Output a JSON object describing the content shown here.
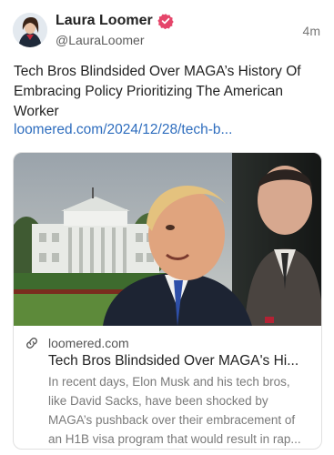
{
  "post": {
    "author": {
      "name": "Laura Loomer",
      "handle": "@LauraLoomer",
      "verified_icon": "verified-badge-icon",
      "verified_color": "#e5456a"
    },
    "time": "4m",
    "text": "Tech Bros Blindsided Over MAGA’s History Of Embracing Policy Prioritizing The American Worker",
    "link": "loomered.com/2024/12/28/tech-b..."
  },
  "link_card": {
    "image": "article-preview-image",
    "domain": "loomered.com",
    "title": "Tech Bros Blindsided Over MAGA's Hi...",
    "description_lines": [
      "In recent days, Elon Musk and his tech bros,",
      "like David Sacks, have been shocked by",
      "MAGA’s pushback over their embracement of",
      "an H1B visa program that would result in rap..."
    ]
  },
  "colors": {
    "link": "#2e6dbe",
    "secondary_text": "#5c5c5c"
  }
}
